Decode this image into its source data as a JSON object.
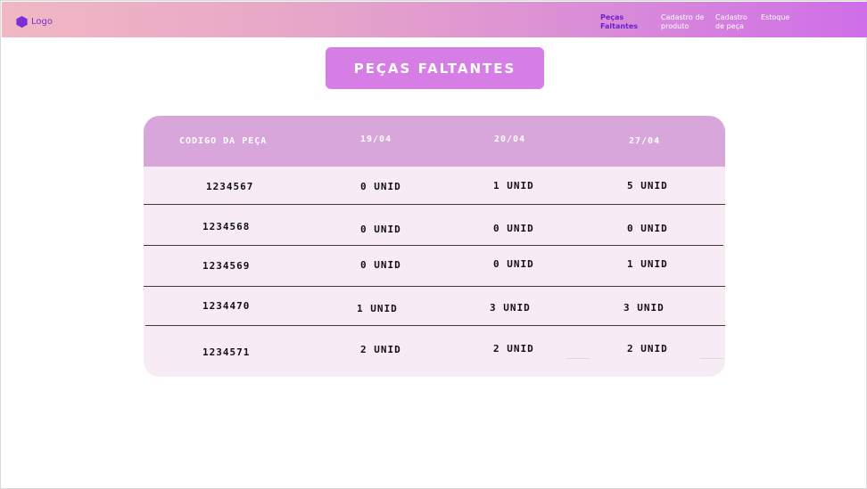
{
  "nav": {
    "logo_label": "Logo",
    "items": [
      {
        "label": "Peças\nFaltantes",
        "active": true
      },
      {
        "label": "Cadastro de\nproduto",
        "active": false
      },
      {
        "label": "Cadastro\nde peça",
        "active": false
      },
      {
        "label": "Estoque",
        "active": false
      }
    ]
  },
  "page": {
    "title": "PEÇAS FALTANTES"
  },
  "table": {
    "headers": [
      "CODIGO DA PEÇA",
      "19/04",
      "20/04",
      "27/04"
    ],
    "rows": [
      [
        "1234567",
        "0 UNID",
        "1 UNID",
        "5 UNID"
      ],
      [
        "1234568",
        "0 UNID",
        "0 UNID",
        "0 UNID"
      ],
      [
        "1234569",
        "0 UNID",
        "0 UNID",
        "1 UNID"
      ],
      [
        "1234470",
        "1 UNID",
        "3 UNID",
        "3 UNID"
      ],
      [
        "1234571",
        "2 UNID",
        "2 UNID",
        "2 UNID"
      ]
    ]
  },
  "colors": {
    "nav_gradient_start": "#f0b8c3",
    "nav_gradient_end": "#cf6ee8",
    "title_bg": "#d77ee6",
    "table_header_bg": "#d8a6da",
    "table_body_bg": "#f7ecf6",
    "logo_color": "#7b2fd6"
  }
}
